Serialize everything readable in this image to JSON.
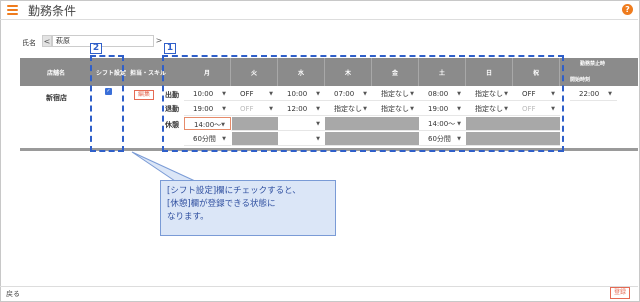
{
  "header": {
    "title": "勤務条件",
    "help": "?"
  },
  "name_selector": {
    "label": "氏名",
    "prev": "<",
    "next": ">",
    "value": "萩原"
  },
  "table": {
    "headers": {
      "store": "店舗名",
      "shift_setting": "シフト設定",
      "qualification": "担当・スキル",
      "days": [
        "月",
        "火",
        "水",
        "木",
        "金",
        "土",
        "日",
        "祝"
      ],
      "limit": "勤務禁止時",
      "start_time": "開始時刻"
    },
    "store_name": "新宿店",
    "shift_checked": "✓",
    "edit_label": "編集",
    "row_labels": {
      "start": "出勤",
      "end": "退勤",
      "break": "休憩"
    },
    "start_row": [
      "10:00",
      "OFF",
      "10:00",
      "07:00",
      "指定なし",
      "08:00",
      "指定なし",
      "OFF"
    ],
    "end_row": [
      "19:00",
      "OFF",
      "12:00",
      "指定なし",
      "指定なし",
      "19:00",
      "指定なし",
      "OFF"
    ],
    "break_row1": [
      "14:00～",
      "",
      "",
      "",
      "",
      "14:00～",
      "",
      ""
    ],
    "break_row2": [
      "60分間",
      "",
      "",
      "",
      "",
      "60分間",
      "",
      ""
    ],
    "limit_start": "22:00"
  },
  "annotations": {
    "label1": "1",
    "label2": "2",
    "callout": [
      "[シフト設定]欄にチェックすると、",
      "[休憩]欄が登録できる状態に",
      "なります。"
    ]
  },
  "footer": {
    "back": "戻る",
    "register": "登録"
  },
  "colors": {
    "accent": "#ef7c1e",
    "annotation": "#2f5fc9",
    "header_bg": "#8b8b8b",
    "edit": "#e56a54"
  }
}
